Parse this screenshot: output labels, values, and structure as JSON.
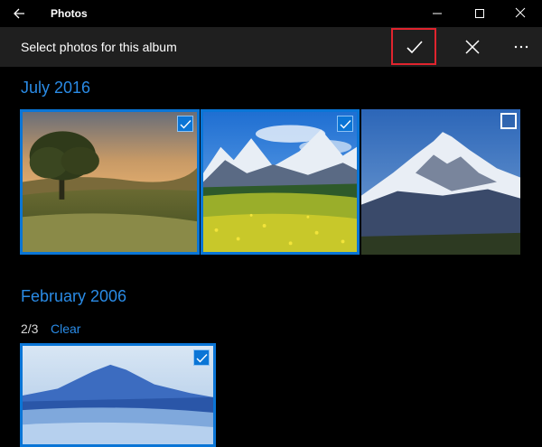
{
  "app": {
    "title": "Photos"
  },
  "toolbar": {
    "label": "Select photos for this album"
  },
  "groups": [
    {
      "title": "July 2016"
    },
    {
      "title": "February 2006",
      "selection_count": "2/3",
      "clear_label": "Clear"
    }
  ],
  "colors": {
    "accent": "#0a75d6",
    "link": "#2a8be6",
    "highlight_border": "#e0242e"
  },
  "photos": [
    {
      "group": "July 2016",
      "subject": "tree-at-sunset",
      "selected": true
    },
    {
      "group": "July 2016",
      "subject": "alpine-meadow",
      "selected": true
    },
    {
      "group": "July 2016",
      "subject": "snowy-mountain",
      "selected": false
    },
    {
      "group": "February 2006",
      "subject": "misty-mountain-blue",
      "selected": true
    }
  ]
}
